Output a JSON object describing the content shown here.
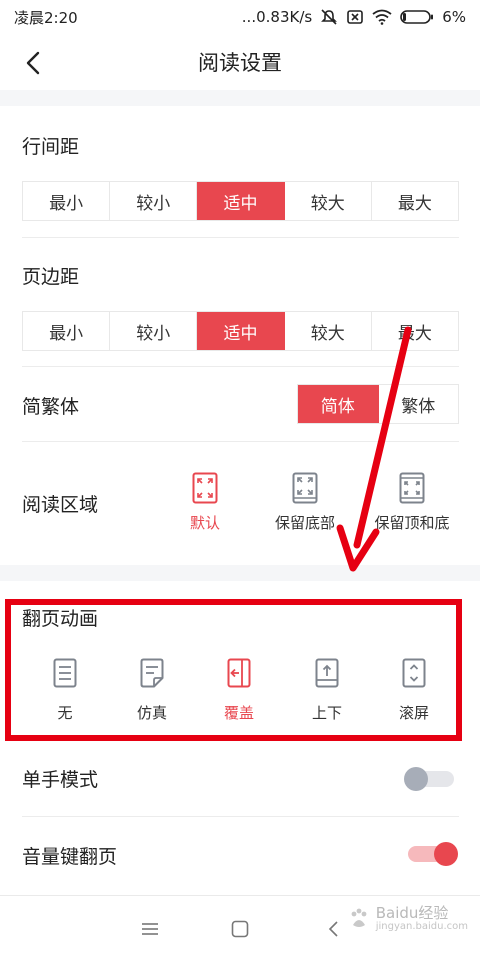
{
  "status_bar": {
    "time": "凌晨2:20",
    "network_speed": "...0.83K/s",
    "battery": "6%"
  },
  "header": {
    "title": "阅读设置"
  },
  "line_spacing": {
    "label": "行间距",
    "options": [
      "最小",
      "较小",
      "适中",
      "较大",
      "最大"
    ],
    "selected": "适中"
  },
  "page_margin": {
    "label": "页边距",
    "options": [
      "最小",
      "较小",
      "适中",
      "较大",
      "最大"
    ],
    "selected": "适中"
  },
  "script_mode": {
    "label": "简繁体",
    "options": [
      "简体",
      "繁体"
    ],
    "selected": "简体"
  },
  "reading_area": {
    "label": "阅读区域",
    "options": [
      "默认",
      "保留底部",
      "保留顶和底"
    ],
    "selected": "默认"
  },
  "page_turn_animation": {
    "label": "翻页动画",
    "options": [
      {
        "label": "无",
        "icon": "page-lines-icon"
      },
      {
        "label": "仿真",
        "icon": "page-curl-icon"
      },
      {
        "label": "覆盖",
        "icon": "page-cover-icon"
      },
      {
        "label": "上下",
        "icon": "page-updown-icon"
      },
      {
        "label": "滚屏",
        "icon": "scroll-screen-icon"
      }
    ],
    "selected": "覆盖"
  },
  "one_hand_mode": {
    "label": "单手模式",
    "enabled": false
  },
  "volume_key_turn": {
    "label": "音量键翻页",
    "enabled": true
  },
  "watermark": {
    "brand": "Baidu经验",
    "domain": "jingyan.baidu.com"
  },
  "colors": {
    "accent": "#e8474f",
    "annotation": "#e60012",
    "toggle_off_track": "#e5e6ea",
    "toggle_off_knob": "#a7adb8"
  }
}
